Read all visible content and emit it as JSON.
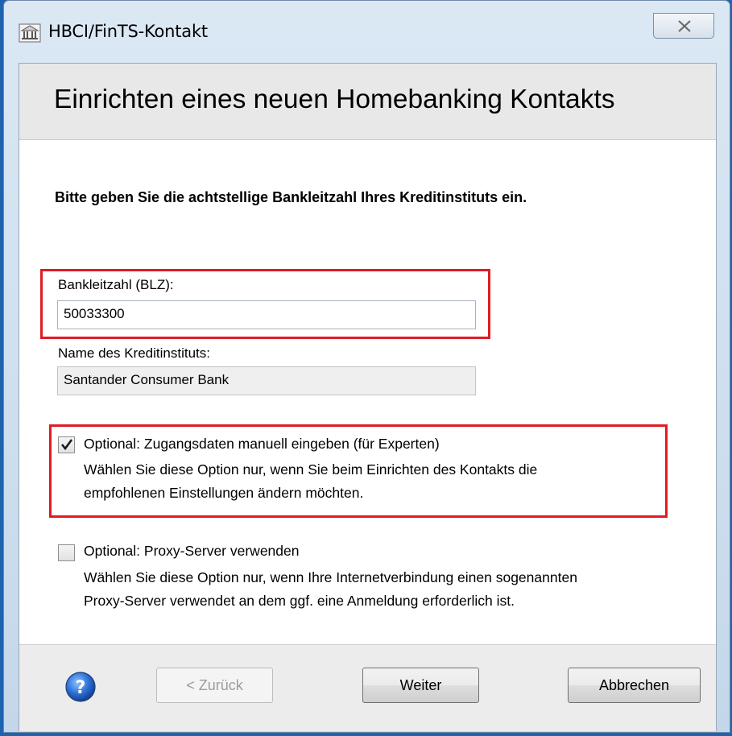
{
  "window": {
    "title": "HBCI/FinTS-Kontakt",
    "close_glyph": "close-icon"
  },
  "header": {
    "title": "Einrichten eines neuen Homebanking Kontakts"
  },
  "instruction": "Bitte geben Sie die achtstellige Bankleitzahl Ihres Kreditinstituts ein.",
  "blz": {
    "label": "Bankleitzahl (BLZ):",
    "value": "50033300"
  },
  "bank_name": {
    "label": "Name des Kreditinstituts:",
    "value": "Santander Consumer Bank"
  },
  "options": [
    {
      "label": "Optional: Zugangsdaten manuell eingeben (für Experten)",
      "description_line1": "Wählen Sie diese Option nur, wenn Sie beim Einrichten des Kontakts die",
      "description_line2": "empfohlenen Einstellungen ändern möchten.",
      "checked": true
    },
    {
      "label": "Optional: Proxy-Server verwenden",
      "description_line1": "Wählen Sie diese Option nur, wenn Ihre Internetverbindung einen sogenannten",
      "description_line2": "Proxy-Server verwendet an dem ggf. eine Anmeldung erforderlich ist.",
      "checked": false
    }
  ],
  "footer": {
    "back_label": "< Zurück",
    "next_label": "Weiter",
    "cancel_label": "Abbrechen",
    "help_icon": "help-icon"
  },
  "colors": {
    "highlight": "#e01b24",
    "desktop": "#1f63ae"
  }
}
